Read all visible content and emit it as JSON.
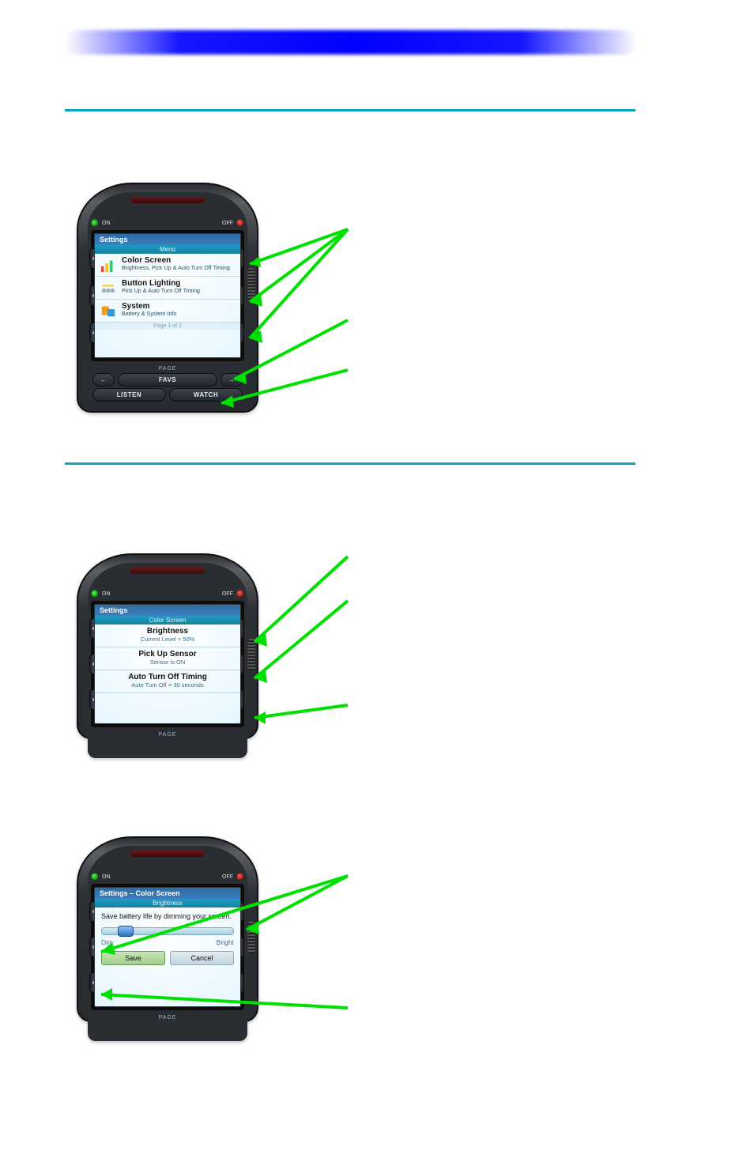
{
  "section1": {
    "remote": {
      "on_label": "ON",
      "off_label": "OFF",
      "screen_title": "Settings",
      "screen_subtitle": "Menu",
      "items": [
        {
          "title": "Color Screen",
          "desc": "Brightness, Pick Up & Auto Turn Off Timing"
        },
        {
          "title": "Button Lighting",
          "desc": "Pick Up & Auto Turn Off Timing"
        },
        {
          "title": "System",
          "desc": "Battery & System Info"
        }
      ],
      "pager": "Page 1 of 2",
      "page_label": "PAGE",
      "hard_buttons": {
        "left_arrow_page": "←",
        "favs": "FAVS",
        "right_arrow_page": "→",
        "listen": "LISTEN",
        "watch": "WATCH"
      }
    }
  },
  "section2": {
    "remote": {
      "on_label": "ON",
      "off_label": "OFF",
      "screen_title": "Settings",
      "screen_subtitle": "Color Screen",
      "items": [
        {
          "title": "Brightness",
          "desc": "Current Level = 50%"
        },
        {
          "title": "Pick Up Sensor",
          "desc": "Sensor is ON"
        },
        {
          "title": "Auto Turn Off Timing",
          "desc": "Auto Turn Off = 30 seconds"
        }
      ],
      "page_label": "PAGE"
    }
  },
  "section3": {
    "remote": {
      "on_label": "ON",
      "off_label": "OFF",
      "screen_title": "Settings – Color Screen",
      "screen_subtitle": "Brightness",
      "body_text": "Save battery life by dimming your screen.",
      "slider": {
        "dim_label": "Dim",
        "bright_label": "Bright"
      },
      "save_label": "Save",
      "cancel_label": "Cancel",
      "page_label": "PAGE"
    }
  }
}
